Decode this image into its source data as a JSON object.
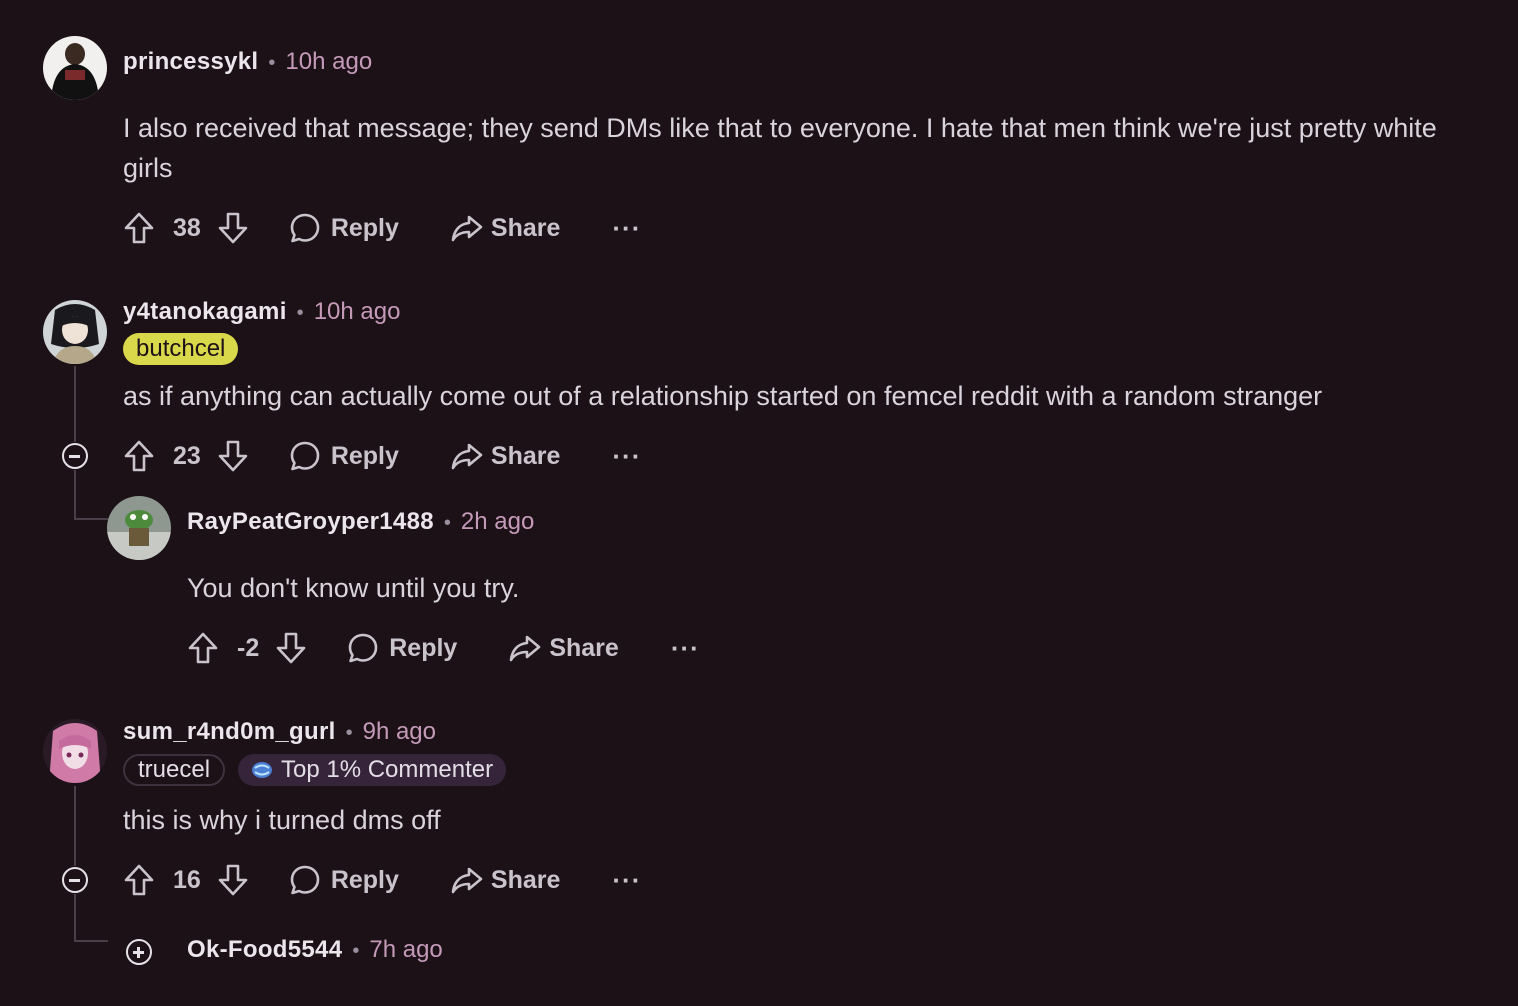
{
  "comments": [
    {
      "username": "princessykl",
      "time": "10h ago",
      "body": "I also received that message; they send DMs like that to everyone. I hate that men think we're just pretty white girls",
      "score": "38",
      "reply": "Reply",
      "share": "Share",
      "more": "···"
    },
    {
      "username": "y4tanokagami",
      "time": "10h ago",
      "flair": "butchcel",
      "flair_color": "#d8d84a",
      "body": "as if anything can actually come out of a relationship started on femcel reddit with a random stranger",
      "score": "23",
      "reply": "Reply",
      "share": "Share",
      "more": "···"
    },
    {
      "username": "RayPeatGroyper1488",
      "time": "2h ago",
      "body": "You don't know until you try.",
      "score": "-2",
      "reply": "Reply",
      "share": "Share",
      "more": "···"
    },
    {
      "username": "sum_r4nd0m_gurl",
      "time": "9h ago",
      "flair": "truecel",
      "achievement": "Top 1% Commenter",
      "body": "this is why i turned dms off",
      "score": "16",
      "reply": "Reply",
      "share": "Share",
      "more": "···"
    },
    {
      "username": "Ok-Food5544",
      "time": "7h ago"
    }
  ],
  "separator": "•",
  "icons": [
    "upvote-icon",
    "downvote-icon",
    "reply-bubble-icon",
    "share-arrow-icon",
    "collapse-minus-icon",
    "expand-plus-icon"
  ]
}
